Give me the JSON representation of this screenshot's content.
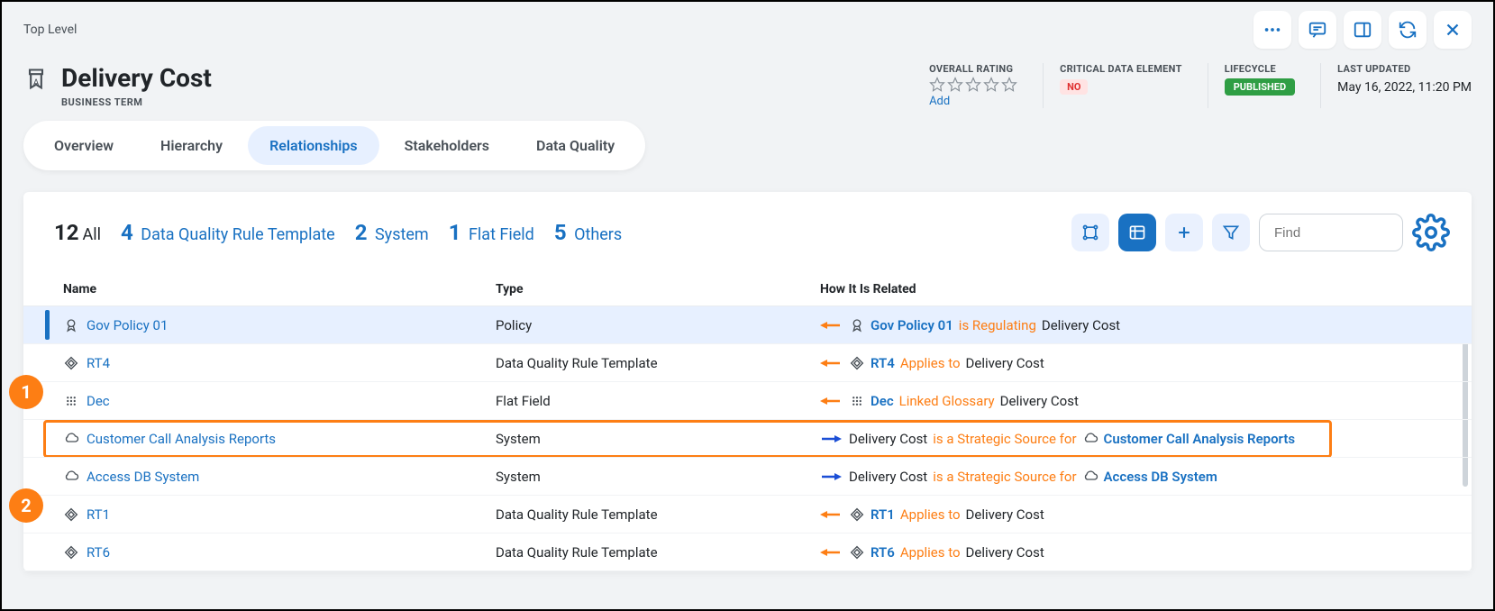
{
  "breadcrumb": "Top Level",
  "header": {
    "title": "Delivery Cost",
    "subtitle": "BUSINESS TERM",
    "meta": {
      "rating": {
        "label": "OVERALL RATING",
        "add": "Add"
      },
      "cde": {
        "label": "CRITICAL DATA ELEMENT",
        "value": "NO"
      },
      "lifecycle": {
        "label": "LIFECYCLE",
        "value": "PUBLISHED"
      },
      "updated": {
        "label": "LAST UPDATED",
        "value": "May 16, 2022, 11:20 PM"
      }
    }
  },
  "tabs": [
    "Overview",
    "Hierarchy",
    "Relationships",
    "Stakeholders",
    "Data Quality"
  ],
  "active_tab": 2,
  "filters": {
    "all": {
      "count": "12",
      "label": "All"
    },
    "dqrt": {
      "count": "4",
      "label": "Data Quality Rule Template"
    },
    "system": {
      "count": "2",
      "label": "System"
    },
    "flatfield": {
      "count": "1",
      "label": "Flat Field"
    },
    "others": {
      "count": "5",
      "label": "Others"
    }
  },
  "search_placeholder": "Find",
  "columns": {
    "name": "Name",
    "type": "Type",
    "rel": "How It Is Related"
  },
  "rows": [
    {
      "icon": "award",
      "name": "Gov Policy 01",
      "type": "Policy",
      "selected": true,
      "arrow": "left",
      "arrow_color": "orange",
      "rel": {
        "subject_icon": "award",
        "subject": "Gov Policy 01",
        "verb": "is Regulating",
        "object": "Delivery Cost",
        "subject_first": true
      }
    },
    {
      "icon": "diamond",
      "name": "RT4",
      "type": "Data Quality Rule Template",
      "arrow": "left",
      "arrow_color": "orange",
      "rel": {
        "subject_icon": "diamond",
        "subject": "RT4",
        "verb": "Applies to",
        "object": "Delivery Cost",
        "subject_first": true
      }
    },
    {
      "icon": "grid",
      "name": "Dec",
      "type": "Flat Field",
      "arrow": "left",
      "arrow_color": "orange",
      "rel": {
        "subject_icon": "grid",
        "subject": "Dec",
        "verb": "Linked Glossary",
        "object": "Delivery Cost",
        "subject_first": true
      }
    },
    {
      "icon": "cloud",
      "name": "Customer Call Analysis Reports",
      "type": "System",
      "arrow": "right",
      "arrow_color": "blue",
      "rel": {
        "subject": "Delivery Cost",
        "verb": "is a Strategic Source for",
        "object_icon": "cloud",
        "object": "Customer Call Analysis Reports",
        "subject_first": false
      }
    },
    {
      "icon": "cloud",
      "name": "Access DB System",
      "type": "System",
      "arrow": "right",
      "arrow_color": "blue",
      "rel": {
        "subject": "Delivery Cost",
        "verb": "is a Strategic Source for",
        "object_icon": "cloud",
        "object": "Access DB System",
        "subject_first": false
      }
    },
    {
      "icon": "diamond",
      "name": "RT1",
      "type": "Data Quality Rule Template",
      "arrow": "left",
      "arrow_color": "orange",
      "rel": {
        "subject_icon": "diamond",
        "subject": "RT1",
        "verb": "Applies to",
        "object": "Delivery Cost",
        "subject_first": true
      }
    },
    {
      "icon": "diamond",
      "name": "RT6",
      "type": "Data Quality Rule Template",
      "arrow": "left",
      "arrow_color": "orange",
      "rel": {
        "subject_icon": "diamond",
        "subject": "RT6",
        "verb": "Applies to",
        "object": "Delivery Cost",
        "subject_first": true
      }
    }
  ],
  "callouts": [
    "1",
    "2"
  ]
}
